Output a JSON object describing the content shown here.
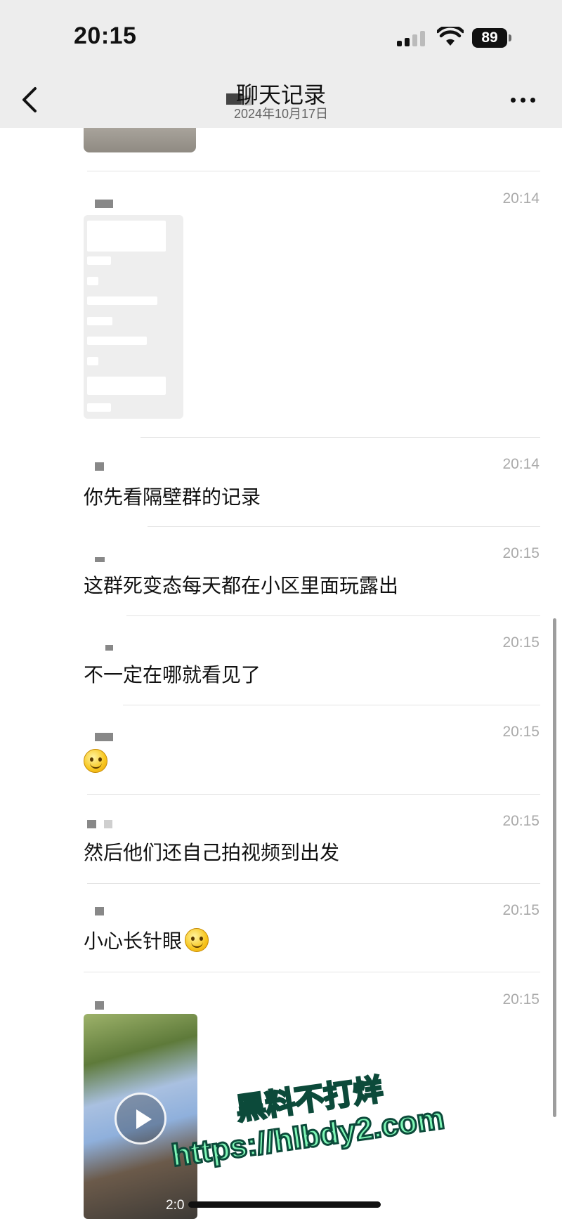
{
  "status_bar": {
    "time": "20:15",
    "battery": "89"
  },
  "header": {
    "title": "聊天记录",
    "date": "2024年10月17日"
  },
  "messages": [
    {
      "id": "m1",
      "type": "image",
      "time": "20:14"
    },
    {
      "id": "m2",
      "type": "text",
      "time": "20:14",
      "text": "你先看隔壁群的记录"
    },
    {
      "id": "m3",
      "type": "text",
      "time": "20:15",
      "text": "这群死变态每天都在小区里面玩露出"
    },
    {
      "id": "m4",
      "type": "text",
      "time": "20:15",
      "text": "不一定在哪就看见了"
    },
    {
      "id": "m5",
      "type": "emoji",
      "time": "20:15",
      "emoji": "smile-emoji"
    },
    {
      "id": "m6",
      "type": "text",
      "time": "20:15",
      "text": "然后他们还自己拍视频到出发"
    },
    {
      "id": "m7",
      "type": "text",
      "time": "20:15",
      "text": "小心长针眼"
    },
    {
      "id": "m8",
      "type": "video",
      "time": "20:15",
      "duration": "2:0"
    }
  ],
  "watermark": {
    "line1": "黑料不打烊",
    "line2": "https://hlbdy2.com"
  }
}
